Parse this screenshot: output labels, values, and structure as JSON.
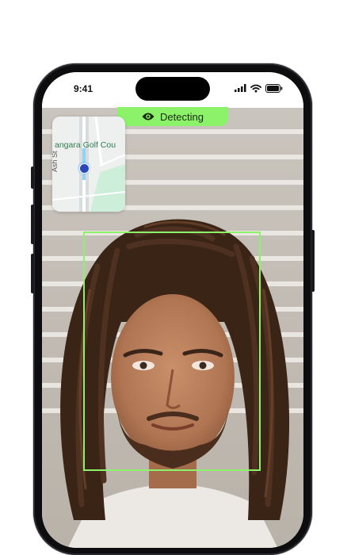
{
  "status_bar": {
    "time": "9:41"
  },
  "detection": {
    "label": "Detecting",
    "icon": "eye-icon",
    "accent_color": "#8cf26a"
  },
  "map": {
    "place_label": "angara Golf Cou",
    "street_label": "Ash St"
  }
}
